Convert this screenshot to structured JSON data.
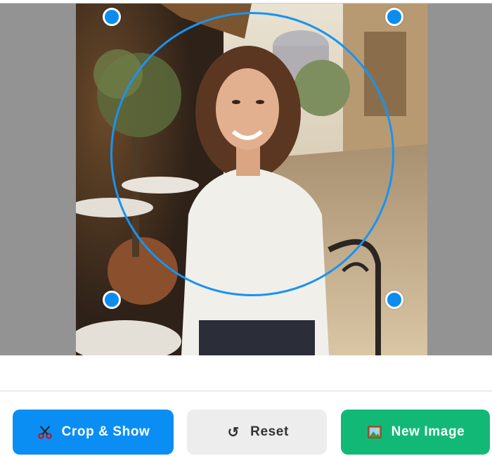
{
  "buttons": {
    "crop_label": "Crop & Show",
    "reset_label": "Reset",
    "new_image_label": "New Image"
  },
  "icons": {
    "crop": "scissors-icon",
    "reset": "reset-arrow-icon",
    "new_image": "picture-frame-icon"
  },
  "colors": {
    "crop_button": "#0b8ef3",
    "reset_button": "#ededed",
    "new_image_button": "#12b976",
    "crop_outline": "#1a93f0",
    "handle": "#0d8cf0",
    "backdrop": "#939393"
  },
  "glyphs": {
    "reset": "↺"
  }
}
